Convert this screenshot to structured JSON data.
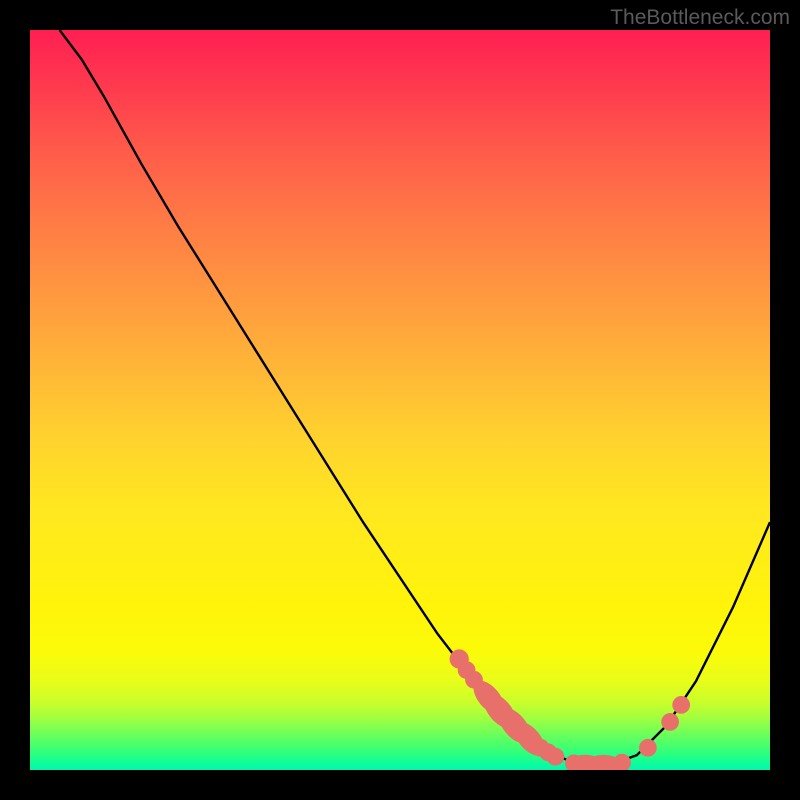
{
  "attribution": "TheBottleneck.com",
  "chart_data": {
    "type": "line",
    "title": "",
    "xlabel": "",
    "ylabel": "",
    "xlim": [
      0,
      100
    ],
    "ylim": [
      0,
      100
    ],
    "legend": false,
    "grid": false,
    "background": "gradient",
    "curve": [
      {
        "x": 4.0,
        "y": 100.0
      },
      {
        "x": 7.0,
        "y": 96.0
      },
      {
        "x": 10.0,
        "y": 91.0
      },
      {
        "x": 15.0,
        "y": 82.0
      },
      {
        "x": 20.0,
        "y": 73.5
      },
      {
        "x": 25.0,
        "y": 65.5
      },
      {
        "x": 30.0,
        "y": 57.5
      },
      {
        "x": 35.0,
        "y": 49.5
      },
      {
        "x": 40.0,
        "y": 41.5
      },
      {
        "x": 45.0,
        "y": 33.5
      },
      {
        "x": 50.0,
        "y": 26.0
      },
      {
        "x": 55.0,
        "y": 18.5
      },
      {
        "x": 60.0,
        "y": 12.0
      },
      {
        "x": 65.0,
        "y": 6.5
      },
      {
        "x": 70.0,
        "y": 2.4
      },
      {
        "x": 74.0,
        "y": 0.8
      },
      {
        "x": 78.0,
        "y": 0.6
      },
      {
        "x": 82.0,
        "y": 2.0
      },
      {
        "x": 86.0,
        "y": 6.0
      },
      {
        "x": 90.0,
        "y": 12.0
      },
      {
        "x": 95.0,
        "y": 22.0
      },
      {
        "x": 100.0,
        "y": 33.5
      }
    ],
    "markers": [
      {
        "x": 58.0,
        "y": 15.0,
        "r": 1.3
      },
      {
        "x": 59.0,
        "y": 13.5,
        "r": 1.2
      },
      {
        "x": 60.0,
        "y": 12.2,
        "r": 1.2
      },
      {
        "x": 62.0,
        "y": 9.8,
        "r": 1.7,
        "elongated": true
      },
      {
        "x": 63.5,
        "y": 8.0,
        "r": 1.8,
        "elongated": true
      },
      {
        "x": 65.5,
        "y": 6.0,
        "r": 1.8,
        "elongated": true
      },
      {
        "x": 67.5,
        "y": 4.2,
        "r": 1.7,
        "elongated": true
      },
      {
        "x": 69.0,
        "y": 3.0,
        "r": 1.2
      },
      {
        "x": 70.0,
        "y": 2.4,
        "r": 1.2
      },
      {
        "x": 71.0,
        "y": 1.8,
        "r": 1.2
      },
      {
        "x": 73.5,
        "y": 0.9,
        "r": 1.2
      },
      {
        "x": 75.0,
        "y": 0.7,
        "r": 1.6,
        "elongated_h": true
      },
      {
        "x": 77.5,
        "y": 0.6,
        "r": 1.7,
        "elongated_h": true
      },
      {
        "x": 80.0,
        "y": 1.0,
        "r": 1.2
      },
      {
        "x": 83.5,
        "y": 3.0,
        "r": 1.2
      },
      {
        "x": 86.5,
        "y": 6.5,
        "r": 1.2
      },
      {
        "x": 88.0,
        "y": 8.8,
        "r": 1.2
      }
    ],
    "marker_color": "#e8706a",
    "line_color": "#000000"
  }
}
